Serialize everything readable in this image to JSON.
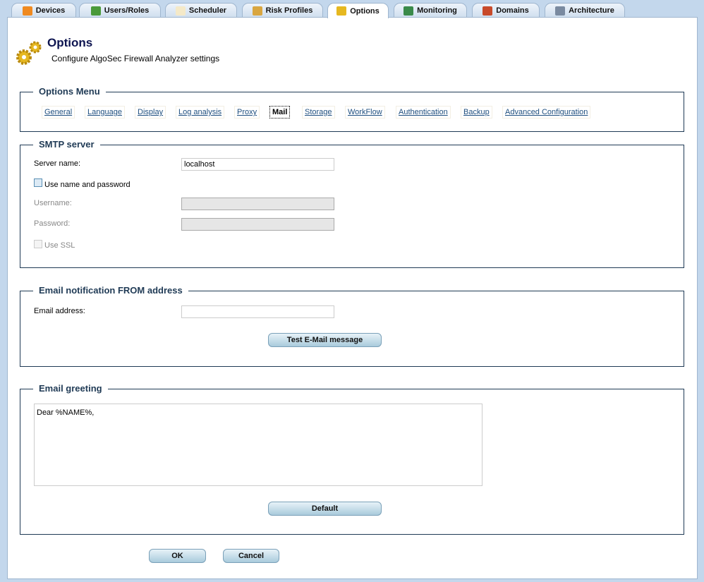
{
  "tabs": [
    {
      "label": "Devices",
      "icon": "devices-icon",
      "color": "#f08a20"
    },
    {
      "label": "Users/Roles",
      "icon": "users-icon",
      "color": "#4a9a3a"
    },
    {
      "label": "Scheduler",
      "icon": "calendar-icon",
      "color": "#f4e9c8"
    },
    {
      "label": "Risk Profiles",
      "icon": "risk-profile-icon",
      "color": "#d9a640"
    },
    {
      "label": "Options",
      "icon": "gears-icon",
      "color": "#e6b820"
    },
    {
      "label": "Monitoring",
      "icon": "monitoring-icon",
      "color": "#3a8a4a"
    },
    {
      "label": "Domains",
      "icon": "domains-icon",
      "color": "#c84a2a"
    },
    {
      "label": "Architecture",
      "icon": "architecture-icon",
      "color": "#7a8aa0"
    }
  ],
  "header": {
    "title": "Options",
    "subtitle": "Configure AlgoSec Firewall Analyzer settings"
  },
  "options_menu": {
    "legend": "Options Menu",
    "items": [
      "General",
      "Language",
      "Display",
      "Log analysis",
      "Proxy",
      "Mail",
      "Storage",
      "WorkFlow",
      "Authentication",
      "Backup",
      "Advanced Configuration"
    ],
    "selected": "Mail"
  },
  "smtp": {
    "legend": "SMTP server",
    "server_label": "Server name:",
    "server_value": "localhost",
    "use_auth_label": "Use name and password",
    "username_label": "Username:",
    "password_label": "Password:",
    "ssl_label": "Use SSL"
  },
  "from": {
    "legend": "Email notification FROM address",
    "email_label": "Email address:",
    "email_value": "",
    "test_button": "Test E-Mail message"
  },
  "greeting": {
    "legend": "Email greeting",
    "text": "Dear %NAME%,",
    "default_button": "Default"
  },
  "footer": {
    "ok": "OK",
    "cancel": "Cancel"
  }
}
